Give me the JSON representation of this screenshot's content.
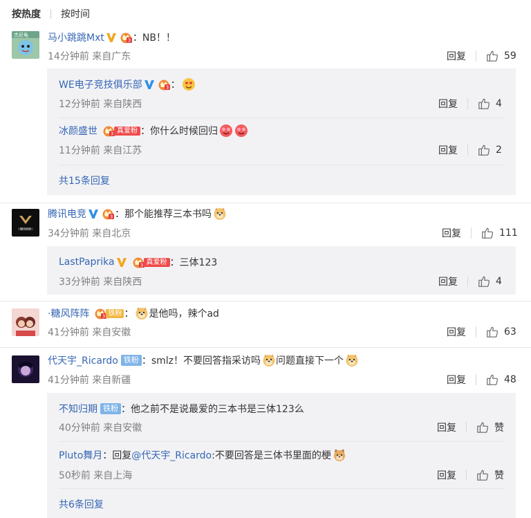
{
  "tabs": {
    "active": "按热度",
    "inactive": "按时间"
  },
  "actions": {
    "reply": "回复",
    "like_zero": "赞"
  },
  "fans": {
    "love": "真爱粉",
    "iron": "铁粉"
  },
  "comments": [
    {
      "user": "马小跳跳Mxt",
      "text": "NB！！",
      "meta": "14分钟前 来自广东",
      "likes": "59",
      "replies": [
        {
          "user": "WE电子竞技俱乐部",
          "text": "",
          "meta": "12分钟前 来自陕西",
          "likes": "4"
        },
        {
          "user": "冰颜盛世",
          "text": "你什么时候回归",
          "meta": "11分钟前 来自江苏",
          "likes": "2"
        }
      ],
      "more": "共15条回复"
    },
    {
      "user": "腾讯电竞",
      "text": "那个能推荐三本书吗",
      "meta": "34分钟前 来自北京",
      "likes": "111",
      "replies": [
        {
          "user": "LastPaprika",
          "text": "三体123",
          "meta": "33分钟前 来自陕西",
          "likes": "4"
        }
      ]
    },
    {
      "user": "·糖风阵阵",
      "text": "是他吗，辣个ad",
      "meta": "41分钟前 来自安徽",
      "likes": "63"
    },
    {
      "user": "代天宇_Ricardo",
      "text_a": "smlz！不要回答指采访吗",
      "text_b": "问题直接下一个",
      "meta": "41分钟前 来自新疆",
      "likes": "48",
      "replies": [
        {
          "user": "不知归期",
          "text": "他之前不是说最爱的三本书是三体123么",
          "meta": "40分钟前 来自安徽"
        },
        {
          "user": "Pluto舞月",
          "text_pre": "回复",
          "mention": "@代天宇_Ricardo",
          "text": ":不要回答是三体书里面的梗",
          "meta": "50秒前 来自上海"
        }
      ],
      "more": "共6条回复"
    }
  ],
  "colors": {
    "link": "#3566b3",
    "meta": "#808080",
    "subbox": "#f2f2f5",
    "vip": "#f2a51a",
    "verified": "#2f8fe6"
  }
}
